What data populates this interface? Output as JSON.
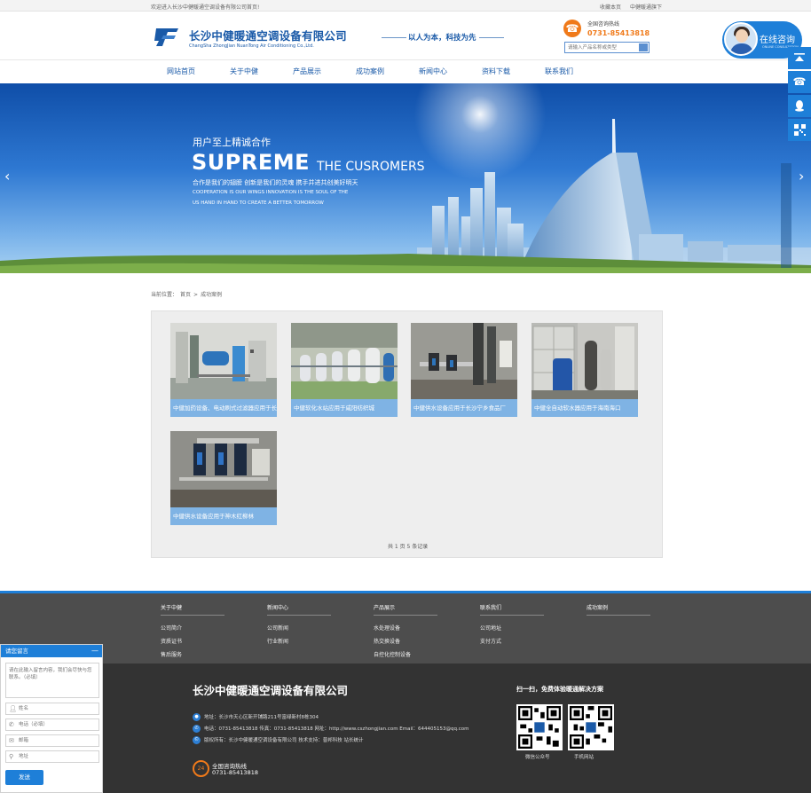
{
  "topbar": {
    "welcome": "欢迎进入长沙中健暖通空调设备有限公司首页!",
    "links": [
      "收藏本页",
      "中健暖通旗下"
    ]
  },
  "header": {
    "brand_cn": "长沙中健暖通空调设备有限公司",
    "brand_en": "ChangSha ZhongJian NuanTong Air Conditioning Co.,Ltd.",
    "slogan": "以人为本，科技为先",
    "hotline_label": "全国咨询热线",
    "hotline_number": "0731-85413818",
    "search_placeholder": "请输入产品名称或类型",
    "consult_title": "在线咨询",
    "consult_sub": "ONLINE CONSULTATION"
  },
  "nav": [
    "网站首页",
    "关于中健",
    "产品展示",
    "成功案例",
    "新闻中心",
    "资料下载",
    "联系我们"
  ],
  "banner": {
    "cn_title": "用户至上精诚合作",
    "big": "SUPREME",
    "small": "THE CUSROMERS",
    "line1": "合作是我们的翅膀  创新是我们的灵魂  携手并进共创美好明天",
    "line2": "COOPERATION IS OUR WINGS INNOVATION IS THE SOUL OF THE",
    "line3": "US HAND IN HAND TO CREATE A BETTER TOMORROW"
  },
  "sidebar_icons": [
    "back-to-top-icon",
    "phone-icon",
    "qq-icon",
    "qrcode-icon"
  ],
  "breadcrumb": [
    "当前位置：",
    "首页",
    ">",
    "成功案例"
  ],
  "cases": [
    {
      "title": "中健加药设备、电动刷式过滤器应用于长沙某水厂"
    },
    {
      "title": "中健软化水站应用于咸阳纺织城"
    },
    {
      "title": "中健供水设备应用于长沙宁乡食品厂"
    },
    {
      "title": "中健全自动软水器应用于海南海口"
    },
    {
      "title": "中健供水设备应用于神木红柳林"
    }
  ],
  "pager": "共 1 页 5 条记录",
  "footer_cols": [
    {
      "head": "关于中健",
      "items": [
        "公司简介",
        "资质证书",
        "售后服务"
      ]
    },
    {
      "head": "新闻中心",
      "items": [
        "公司新闻",
        "行业新闻"
      ]
    },
    {
      "head": "产品展示",
      "items": [
        "水处理设备",
        "热交换设备",
        "自控化控制设备"
      ]
    },
    {
      "head": "联系我们",
      "items": [
        "公司地址",
        "支付方式"
      ]
    },
    {
      "head": "成功案例",
      "items": []
    }
  ],
  "footer": {
    "company": "长沙中健暖通空调设备有限公司",
    "address": "地址：长沙市天心区新开铺路211号富绿新村8栋304",
    "contact": "电话：0731-85413818   传真：0731-85413818   网址：http://www.cszhongjian.com   Email：644405153@qq.com",
    "copyright": "版权所有：长沙中健暖通空调设备有限公司   技术支持：普邦科技   站长统计",
    "hotline_label": "全国咨询热线",
    "hotline_number": "0731-85413818",
    "scan_title": "扫一扫，免费体验暖通解决方案",
    "qr1_label": "微信公众号",
    "qr2_label": "手机网站"
  },
  "message": {
    "title": "请您留言",
    "textarea_placeholder": "请在此输入留言内容，我们会尽快与您联系。（必填）",
    "name_placeholder": "姓名",
    "phone_placeholder": "电话（必填）",
    "email_placeholder": "邮箱",
    "address_placeholder": "地址",
    "send": "发送"
  },
  "colors": {
    "primary": "#1e7fd8",
    "brand": "#1a5aa8",
    "accent": "#f07a1a",
    "footer_dark": "#333333"
  }
}
